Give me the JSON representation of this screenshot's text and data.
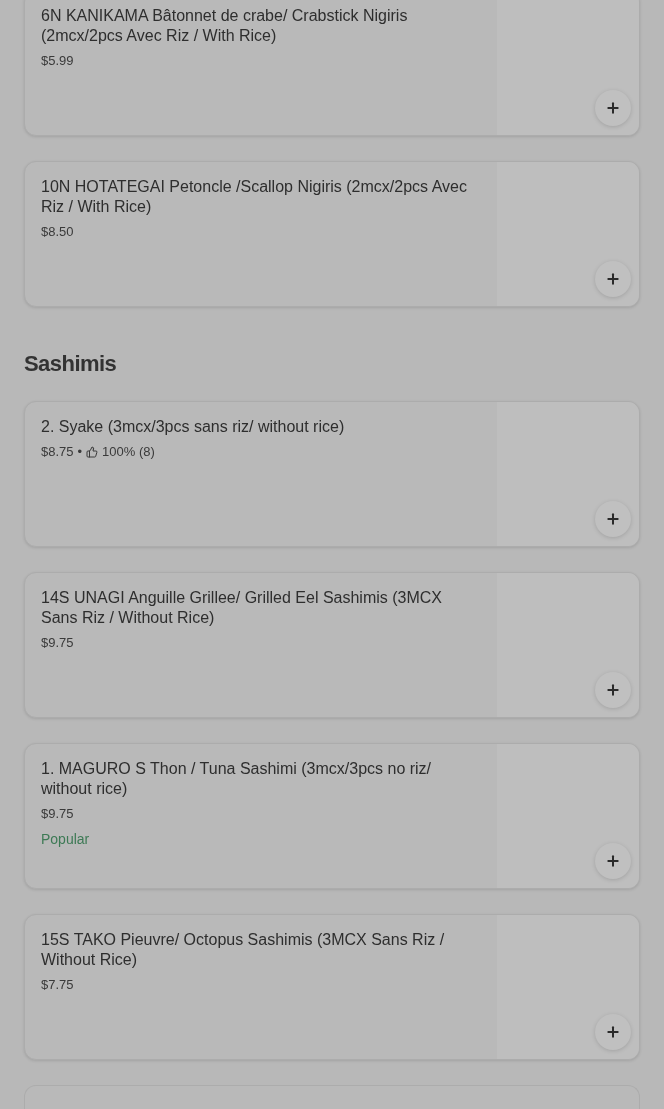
{
  "sections": [
    {
      "items": [
        {
          "kind": "item",
          "name": "6N KANIKAMA Bâtonnet de crabe/ Crabstick Nigiris (2mcx/2pcs Avec Riz / With Rice)",
          "price": "$5.99"
        },
        {
          "kind": "item",
          "name": "10N HOTATEGAI Petoncle /Scallop Nigiris (2mcx/2pcs Avec Riz / With Rice)",
          "price": "$8.50"
        }
      ]
    },
    {
      "title": "Sashimis",
      "items": [
        {
          "kind": "item",
          "name": "2. Syake (3mcx/3pcs sans riz/ without rice)",
          "price": "$8.75",
          "separator": "•",
          "rating": "100% (8)"
        },
        {
          "kind": "item",
          "name": "14S UNAGI Anguille Grillee/ Grilled Eel Sashimis (3MCX Sans Riz / Without Rice)",
          "price": "$9.75"
        },
        {
          "kind": "item",
          "name": "1. MAGURO S Thon / Tuna Sashimi (3mcx/3pcs no riz/ without rice)",
          "price": "$9.75",
          "tag": "Popular"
        },
        {
          "kind": "item",
          "name": "15S TAKO Pieuvre/ Octopus Sashimis (3MCX Sans Riz / Without Rice)",
          "price": "$7.75"
        },
        {
          "kind": "obscured"
        }
      ]
    }
  ]
}
